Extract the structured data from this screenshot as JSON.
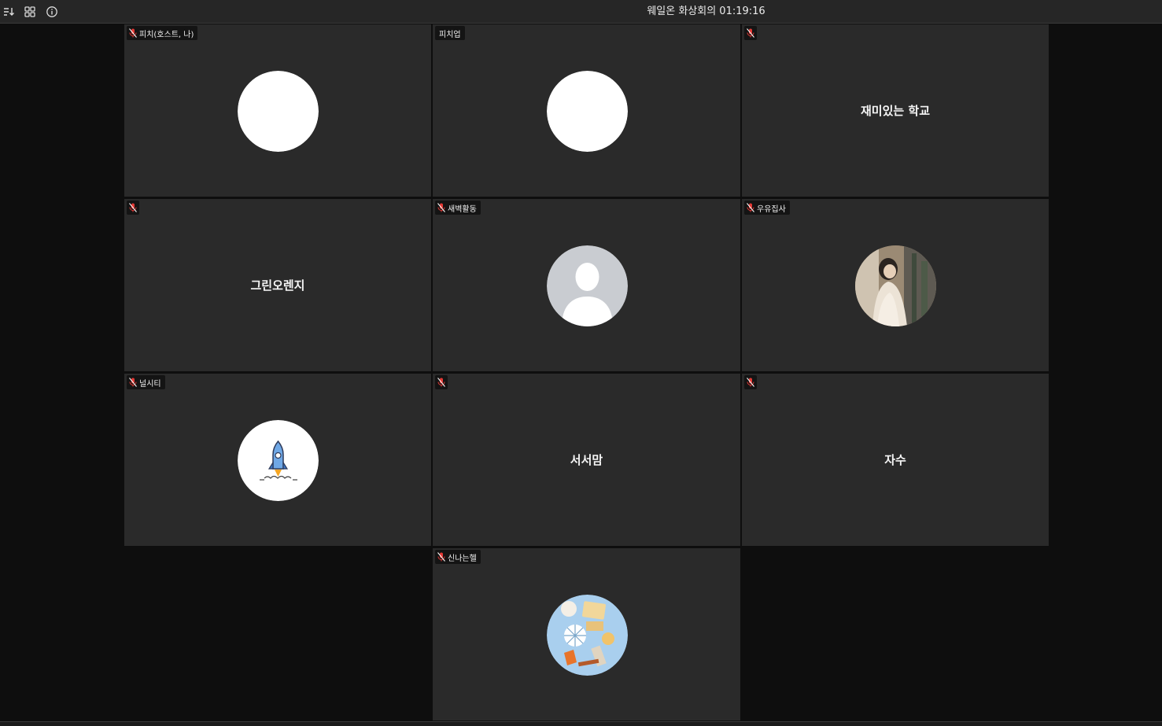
{
  "window": {
    "title": "웨일온 화상회의 01:19:16"
  },
  "toolbar": {
    "icons": [
      "sort-icon",
      "grid-view-icon",
      "info-icon"
    ]
  },
  "participants": [
    {
      "label": "피치(호스트, 나)",
      "display": "avatar",
      "avatar": "white-circle",
      "muted": true
    },
    {
      "label": "피치업",
      "display": "avatar",
      "avatar": "white-circle",
      "muted": false
    },
    {
      "label": "",
      "display": "name",
      "name": "재미있는 학교",
      "muted": true
    },
    {
      "label": "",
      "display": "name",
      "name": "그린오렌지",
      "muted": true
    },
    {
      "label": "새벽활동",
      "display": "avatar",
      "avatar": "default-person",
      "muted": true
    },
    {
      "label": "우유집사",
      "display": "avatar",
      "avatar": "photo-woman",
      "muted": true
    },
    {
      "label": "널시티",
      "display": "avatar",
      "avatar": "rocket",
      "muted": true
    },
    {
      "label": "",
      "display": "name",
      "name": "서서맘",
      "muted": true
    },
    {
      "label": "",
      "display": "name",
      "name": "자수",
      "muted": true
    },
    {
      "label": "신나는헬",
      "display": "avatar",
      "avatar": "flatlay-items",
      "muted": true
    }
  ],
  "colors": {
    "mic_muted": "#e53935",
    "tile_bg": "#2a2a2a",
    "topbar_bg": "#262626"
  }
}
